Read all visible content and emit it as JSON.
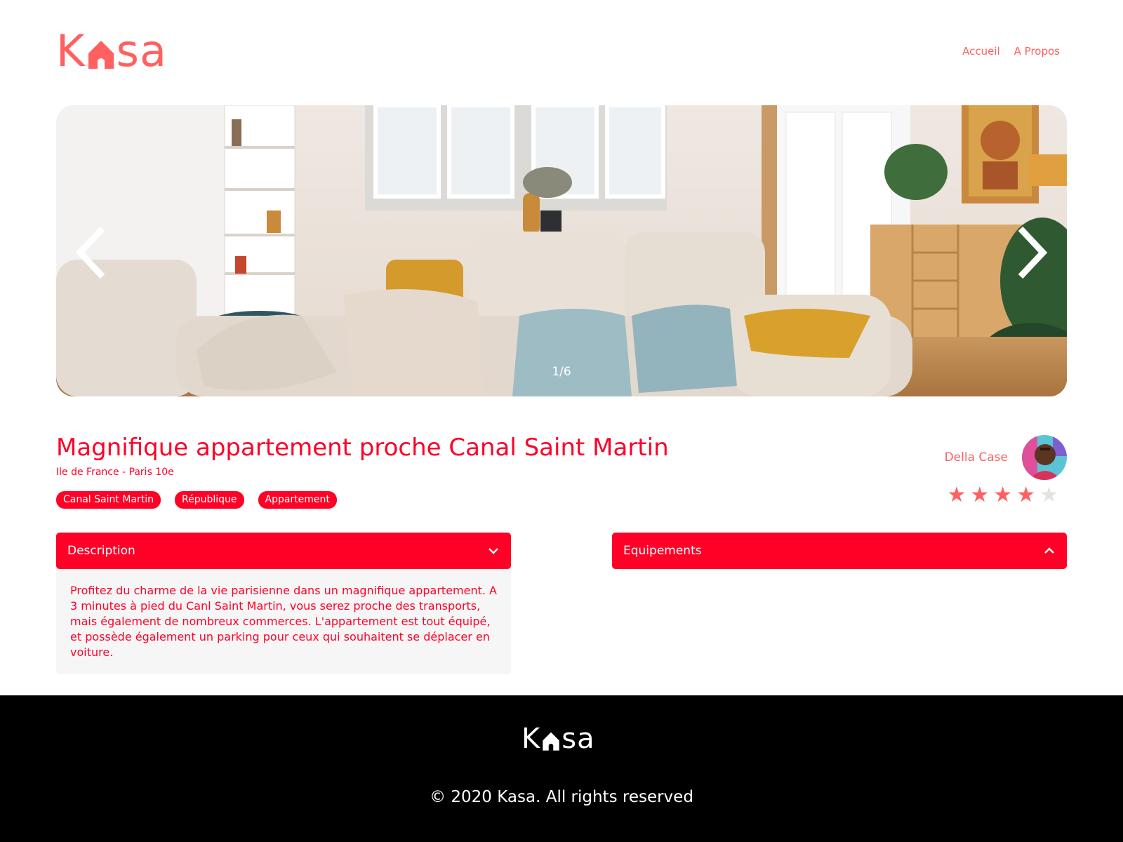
{
  "brand": {
    "logo_letters": [
      "K",
      "s",
      "a"
    ],
    "color": "#FF6060",
    "accent": "#FF0027"
  },
  "nav": {
    "items": [
      "Accueil",
      "A Propos"
    ]
  },
  "carousel": {
    "counter": "1/6",
    "prev_icon": "chevron-left-icon",
    "next_icon": "chevron-right-icon"
  },
  "listing": {
    "title": "Magnifique appartement proche Canal Saint Martin",
    "location": "Ile de France - Paris 10e",
    "tags": [
      "Canal Saint Martin",
      "République",
      "Appartement"
    ]
  },
  "host": {
    "name": "Della Case",
    "rating": 4,
    "rating_max": 5
  },
  "collapses": {
    "description": {
      "label": "Description",
      "icon": "chevron-down-icon",
      "text": "Profitez du charme de la vie parisienne dans un magnifique appartement. A 3 minutes à pied du Canl Saint Martin, vous serez proche des transports, mais également de nombreux commerces. L'appartement est tout équipé, et possède également un parking pour ceux qui souhaitent se déplacer en voiture."
    },
    "equipements": {
      "label": "Equipements",
      "icon": "chevron-up-icon"
    }
  },
  "footer": {
    "copyright": "© 2020 Kasa. All rights reserved"
  }
}
